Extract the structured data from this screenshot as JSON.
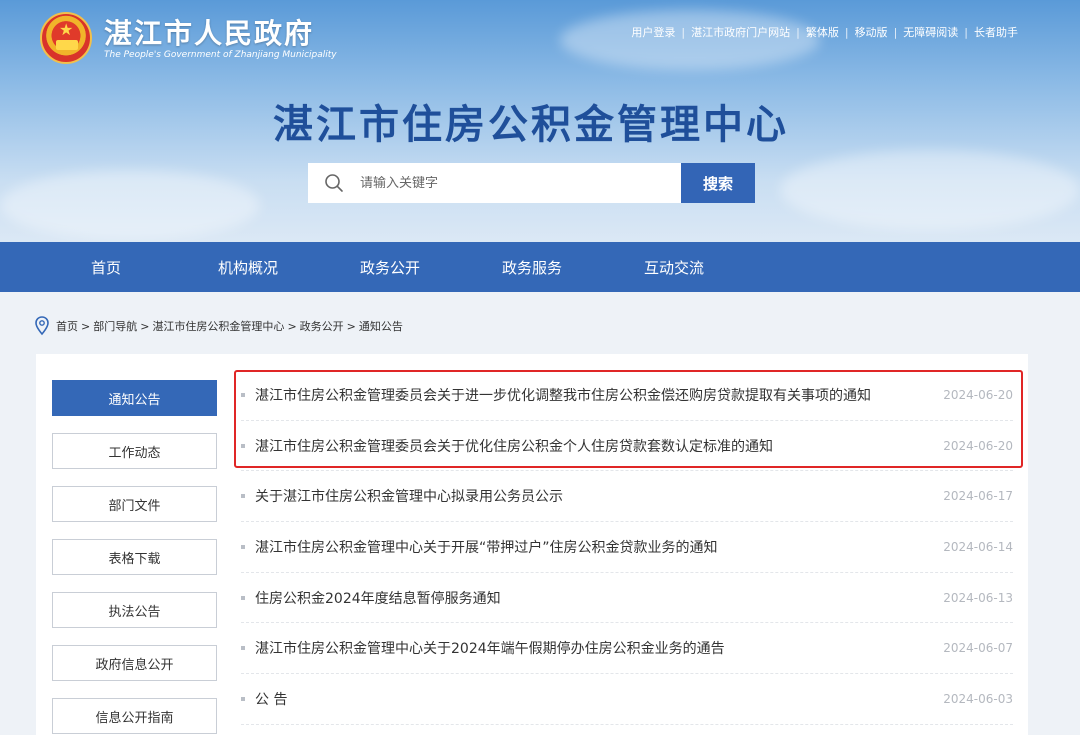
{
  "header": {
    "site_name": "湛江市人民政府",
    "site_sub": "The People's Government of Zhanjiang Municipality",
    "toplinks": [
      "用户登录",
      "湛江市政府门户网站",
      "繁体版",
      "移动版",
      "无障碍阅读",
      "长者助手"
    ],
    "main_title": "湛江市住房公积金管理中心"
  },
  "search": {
    "placeholder": "请输入关键字",
    "button": "搜索"
  },
  "nav": [
    "首页",
    "机构概况",
    "政务公开",
    "政务服务",
    "互动交流"
  ],
  "breadcrumb": [
    "首页",
    "部门导航",
    "湛江市住房公积金管理中心",
    "政务公开",
    "通知公告"
  ],
  "sidebar": [
    {
      "label": "通知公告",
      "active": true
    },
    {
      "label": "工作动态",
      "active": false
    },
    {
      "label": "部门文件",
      "active": false
    },
    {
      "label": "表格下载",
      "active": false
    },
    {
      "label": "执法公告",
      "active": false
    },
    {
      "label": "政府信息公开",
      "active": false
    },
    {
      "label": "信息公开指南",
      "active": false
    }
  ],
  "articles": [
    {
      "title": "湛江市住房公积金管理委员会关于进一步优化调整我市住房公积金偿还购房贷款提取有关事项的通知",
      "date": "2024-06-20"
    },
    {
      "title": "湛江市住房公积金管理委员会关于优化住房公积金个人住房贷款套数认定标准的通知",
      "date": "2024-06-20"
    },
    {
      "title": "关于湛江市住房公积金管理中心拟录用公务员公示",
      "date": "2024-06-17"
    },
    {
      "title": "湛江市住房公积金管理中心关于开展“带押过户”住房公积金贷款业务的通知",
      "date": "2024-06-14"
    },
    {
      "title": "住房公积金2024年度结息暂停服务通知",
      "date": "2024-06-13"
    },
    {
      "title": "湛江市住房公积金管理中心关于2024年端午假期停办住房公积金业务的通告",
      "date": "2024-06-07"
    },
    {
      "title": "公 告",
      "date": "2024-06-03"
    }
  ],
  "colors": {
    "brand": "#3468b7",
    "title": "#1f4f9a",
    "highlight": "#e02626"
  }
}
